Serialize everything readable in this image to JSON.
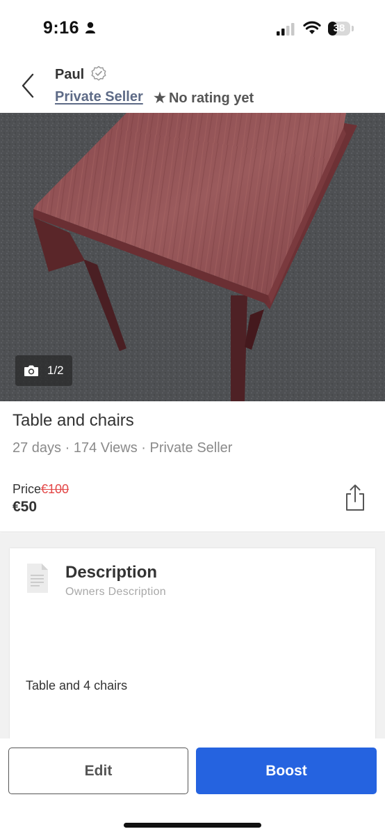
{
  "status_bar": {
    "time": "9:16",
    "battery_level": "38",
    "icons": [
      "person-icon",
      "signal-icon",
      "wifi-icon",
      "battery-icon"
    ]
  },
  "header": {
    "back_icon": "chevron-left-icon",
    "seller_name": "Paul",
    "verified_icon": "verified-badge-icon",
    "seller_type": "Private Seller",
    "rating_star": "★",
    "rating_text": "No rating yet"
  },
  "photo": {
    "counter": "1/2",
    "camera_icon": "camera-icon"
  },
  "listing": {
    "title": "Table and chairs",
    "meta": "27 days · 174 Views · Private Seller",
    "price_label": "Price",
    "old_price": "€100",
    "price": "€50",
    "share_icon": "share-icon"
  },
  "description": {
    "icon": "document-icon",
    "title": "Description",
    "subtitle": "Owners Description",
    "text": "Table and 4 chairs"
  },
  "actions": {
    "edit_label": "Edit",
    "boost_label": "Boost"
  },
  "colors": {
    "accent": "#2563e0",
    "seller_link": "#5d6a86",
    "old_price": "#e34848"
  }
}
